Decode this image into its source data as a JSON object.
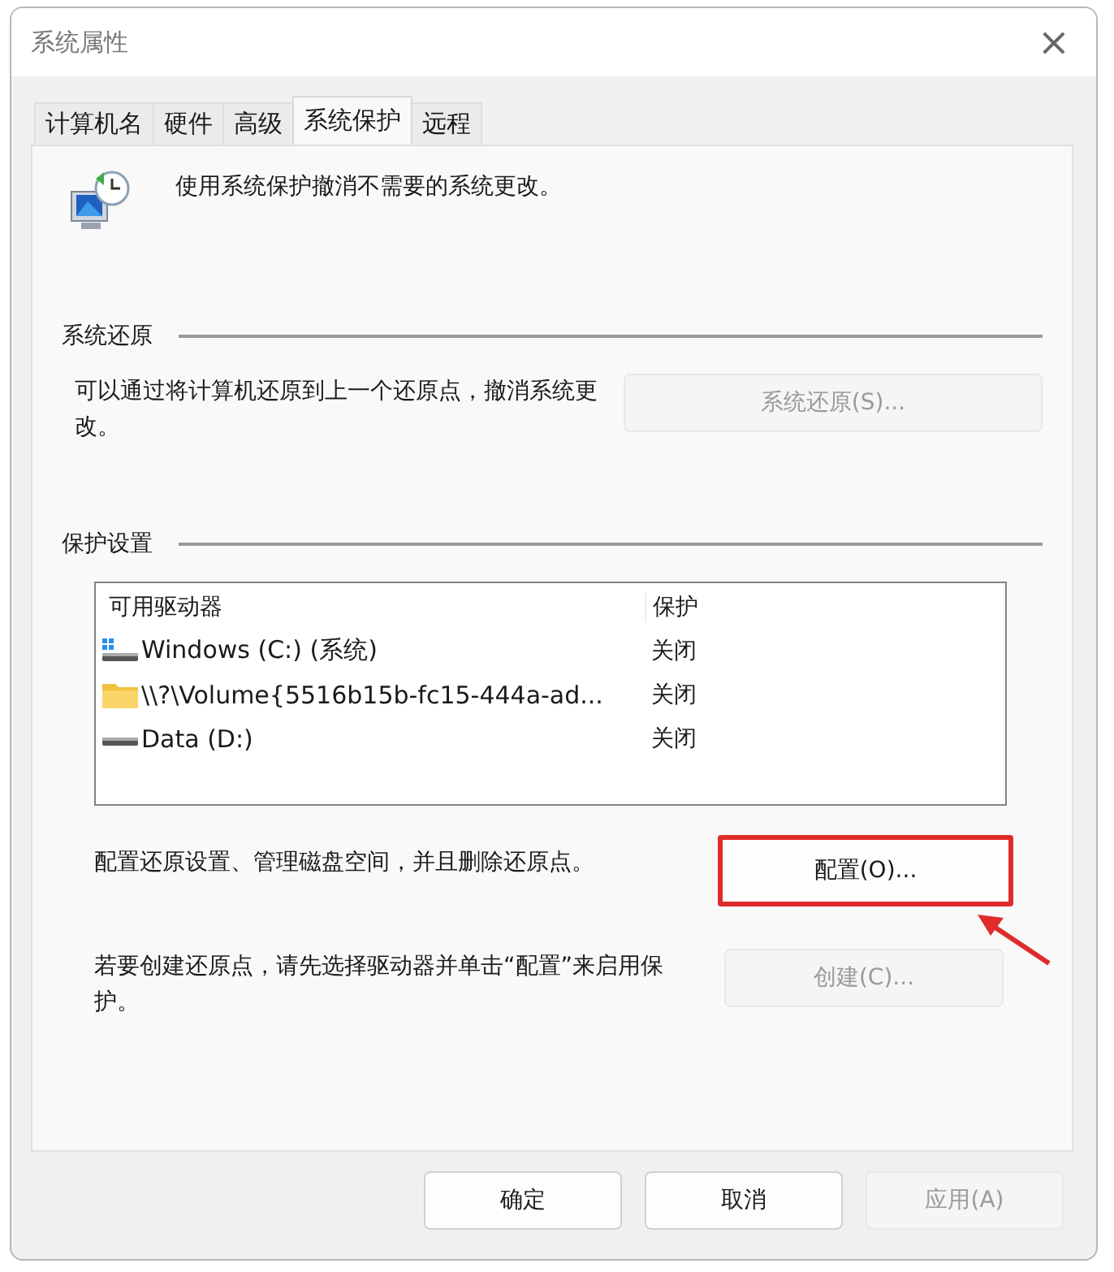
{
  "window": {
    "title": "系统属性",
    "close": "×"
  },
  "tabs": [
    {
      "label": "计算机名",
      "selected": false
    },
    {
      "label": "硬件",
      "selected": false
    },
    {
      "label": "高级",
      "selected": false
    },
    {
      "label": "系统保护",
      "selected": true
    },
    {
      "label": "远程",
      "selected": false
    }
  ],
  "intro": "使用系统保护撤消不需要的系统更改。",
  "restore": {
    "heading": "系统还原",
    "text": "可以通过将计算机还原到上一个还原点，撤消系统更改。",
    "button": {
      "label": "系统还原(S)...",
      "disabled": true
    }
  },
  "protection": {
    "heading": "保护设置",
    "columns": [
      "可用驱动器",
      "保护"
    ],
    "rows": [
      {
        "kind": "system",
        "drive": "Windows (C:) (系统)",
        "protection": "关闭"
      },
      {
        "kind": "folder",
        "drive": "\\\\?\\Volume{5516b15b-fc15-444a-ad...",
        "protection": "关闭"
      },
      {
        "kind": "disk",
        "drive": "Data (D:)",
        "protection": "关闭"
      }
    ],
    "configure": {
      "text": "配置还原设置、管理磁盘空间，并且删除还原点。",
      "button": {
        "label": "配置(O)...",
        "disabled": false,
        "highlighted": true
      }
    },
    "create": {
      "text": "若要创建还原点，请先选择驱动器并单击“配置”来启用保护。",
      "button": {
        "label": "创建(C)...",
        "disabled": true
      }
    }
  },
  "buttons": [
    {
      "label": "确定",
      "disabled": false
    },
    {
      "label": "取消",
      "disabled": false
    },
    {
      "label": "应用(A)",
      "disabled": true
    }
  ]
}
